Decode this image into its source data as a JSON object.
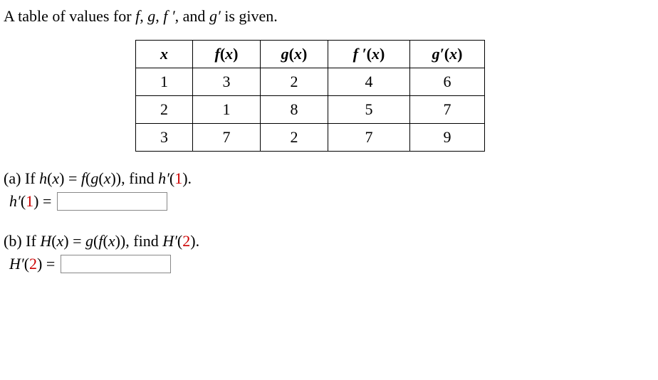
{
  "intro": {
    "prefix": "A table of values for ",
    "f": "f",
    "sep1": ", ",
    "g": "g",
    "sep2": ", ",
    "fp": "f ′",
    "sep3": ", and ",
    "gp": "g′",
    "suffix": " is given."
  },
  "table": {
    "headers": {
      "x": "x",
      "fx": "f",
      "fx_paren_open": "(",
      "fx_x": "x",
      "fx_paren_close": ")",
      "gx": "g",
      "gx_paren_open": "(",
      "gx_x": "x",
      "gx_paren_close": ")",
      "fpx": "f ′",
      "fpx_paren_open": "(",
      "fpx_x": "x",
      "fpx_paren_close": ")",
      "gpx": "g′",
      "gpx_paren_open": "(",
      "gpx_x": "x",
      "gpx_paren_close": ")"
    },
    "rows": [
      {
        "x": "1",
        "fx": "3",
        "gx": "2",
        "fpx": "4",
        "gpx": "6"
      },
      {
        "x": "2",
        "fx": "1",
        "gx": "8",
        "fpx": "5",
        "gpx": "7"
      },
      {
        "x": "3",
        "fx": "7",
        "gx": "2",
        "fpx": "7",
        "gpx": "9"
      }
    ]
  },
  "partA": {
    "label": "(a) If ",
    "hx": "h",
    "paren_open": "(",
    "x": "x",
    "paren_close": ")",
    "equals": " = ",
    "f": "f",
    "g_open": "(",
    "g": "g",
    "gx_open": "(",
    "gx_x": "x",
    "gx_close": ")",
    "g_close": ")",
    "find": ", find ",
    "hprime": "h′",
    "arg_open": "(",
    "arg": "1",
    "arg_close": ")",
    "period": ".",
    "answer_label_h": "h′",
    "answer_label_open": "(",
    "answer_label_arg": "1",
    "answer_label_close": ")",
    "answer_equals": " = ",
    "answer_value": ""
  },
  "partB": {
    "label": "(b) If  ",
    "Hx": "H",
    "paren_open": "(",
    "x": "x",
    "paren_close": ")",
    "equals": " = ",
    "g": "g",
    "f_open": "(",
    "f": "f",
    "fx_open": "(",
    "fx_x": "x",
    "fx_close": ")",
    "f_close": ")",
    "find": ", find ",
    "Hprime": "H′",
    "arg_open": "(",
    "arg": "2",
    "arg_close": ")",
    "period": ".",
    "answer_label_H": "H′",
    "answer_label_open": "(",
    "answer_label_arg": "2",
    "answer_label_close": ")",
    "answer_equals": " = ",
    "answer_value": ""
  }
}
